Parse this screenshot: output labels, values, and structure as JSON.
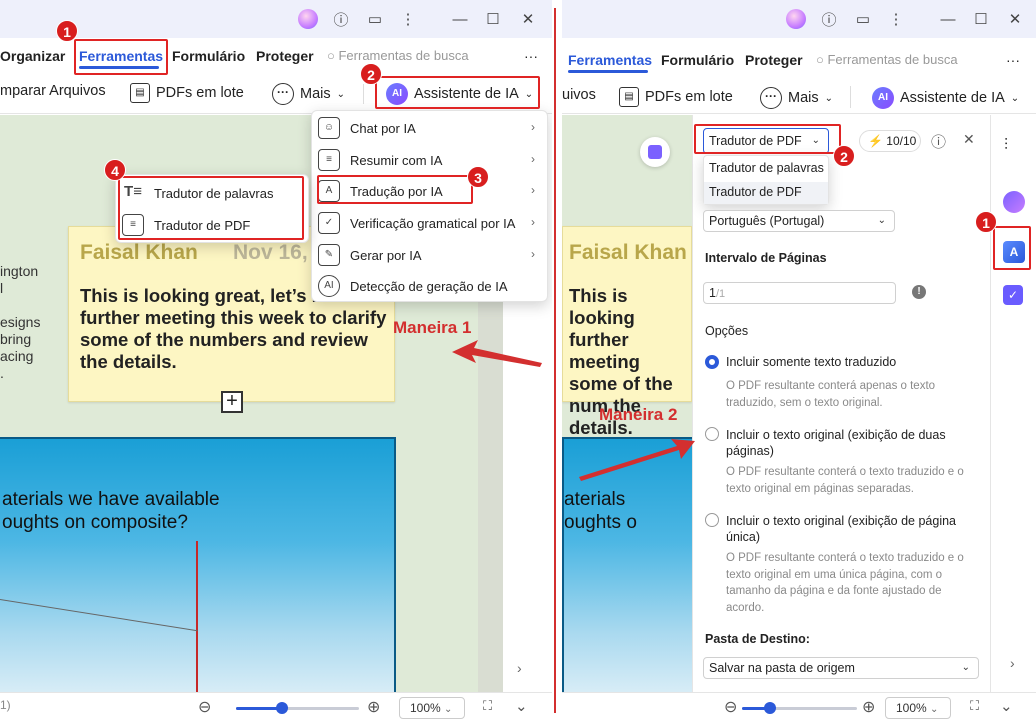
{
  "left": {
    "nav": {
      "organizar": "Organizar",
      "ferramentas": "Ferramentas",
      "formulario": "Formulário",
      "proteger": "Proteger",
      "search_placeholder": "Ferramentas de busca",
      "more": "···"
    },
    "toolbar": {
      "comparar": "mparar Arquivos",
      "pdfs_lote": "PDFs em lote",
      "mais": "Mais",
      "assistente": "Assistente de IA",
      "ai_badge": "AI"
    },
    "ai_menu": [
      {
        "label": "Chat por IA",
        "icon": "robot-chat-icon",
        "chevron": "›"
      },
      {
        "label": "Resumir com IA",
        "icon": "summary-icon",
        "chevron": "›"
      },
      {
        "label": "Tradução por IA",
        "icon": "translate-icon",
        "chevron": "›"
      },
      {
        "label": "Verificação gramatical por IA",
        "icon": "grammar-check-icon",
        "chevron": "›"
      },
      {
        "label": "Gerar por IA",
        "icon": "generate-icon",
        "chevron": "›"
      },
      {
        "label": "Detecção de geração de IA",
        "icon": "ai-detect-icon",
        "chevron": ""
      }
    ],
    "translate_submenu": [
      {
        "label": "Tradutor de palavras",
        "icon": "word-translate-icon"
      },
      {
        "label": "Tradutor de PDF",
        "icon": "pdf-translate-icon"
      }
    ],
    "doc": {
      "side_lines": [
        "ington",
        "l",
        "",
        "esigns",
        " bring",
        " acing",
        "."
      ],
      "note_name": "Faisal Khan",
      "note_date": "Nov 16,",
      "note_text": "This is looking great, let’s have further meeting this week to clarify some of the numbers and review the details.",
      "image_text_1": "aterials we have available",
      "image_text_2": "oughts on composite?"
    },
    "status": {
      "page": "1)",
      "zoom": "100%"
    },
    "badges": [
      "1",
      "2",
      "3",
      "4"
    ],
    "maneira": "Maneira 1"
  },
  "right": {
    "nav": {
      "ferramentas": "Ferramentas",
      "formulario": "Formulário",
      "proteger": "Proteger",
      "search_placeholder": "Ferramentas de busca",
      "more": "···"
    },
    "toolbar": {
      "quivos": "uivos",
      "pdfs_lote": "PDFs em lote",
      "mais": "Mais",
      "assistente": "Assistente de IA",
      "ai_badge": "AI"
    },
    "panel": {
      "selector": "Tradutor de PDF",
      "options_list": [
        "Tradutor de palavras",
        "Tradutor de PDF"
      ],
      "credits": "10/10",
      "language": "Português (Portugal)",
      "page_range_label": "Intervalo de Páginas",
      "page_value": "1",
      "page_total": "/1",
      "options_label": "Opções",
      "opt1": "Incluir somente texto traduzido",
      "opt1_hint": "O PDF resultante conterá apenas o texto traduzido, sem o texto original.",
      "opt2": "Incluir o texto original (exibição de duas páginas)",
      "opt2_hint": "O PDF resultante conterá o texto traduzido e o texto original em páginas separadas.",
      "opt3": "Incluir o texto original (exibição de página única)",
      "opt3_hint": "O PDF resultante conterá o texto traduzido e o texto original em uma única página, com o tamanho da página e da fonte ajustado de acordo.",
      "dest_label": "Pasta de Destino:",
      "dest_value": "Salvar na pasta de origem"
    },
    "doc": {
      "note_name": "Faisal Khan",
      "note_text": "This is looking further meeting some of the num the details.",
      "image_text_1": "aterials",
      "image_text_2": "oughts o"
    },
    "status": {
      "zoom": "100%"
    },
    "badges": [
      "1",
      "2"
    ],
    "maneira": "Maneira 2"
  },
  "colors": {
    "accent": "#2b59d9",
    "highlight": "#e02424",
    "sticky": "#fdf6c3",
    "note_name": "#b8a64a"
  }
}
